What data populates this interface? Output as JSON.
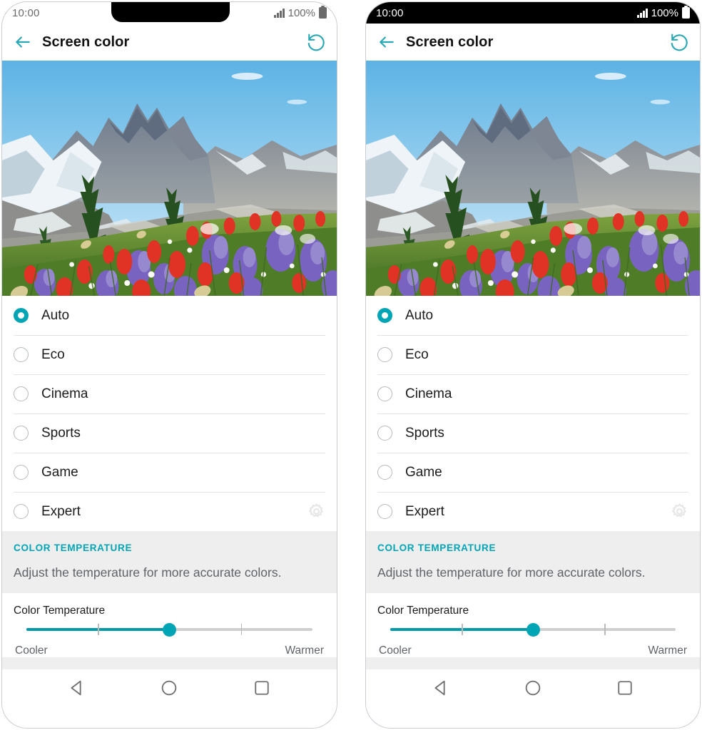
{
  "theme": {
    "accent": "#00a5b5",
    "band_bg": "#eeeeee",
    "text": "#1b1b1b",
    "muted": "#5f6368"
  },
  "status_bar": {
    "time": "10:00",
    "battery_percent": "100%",
    "signal_icon": "signal-bars-icon",
    "battery_icon": "battery-full-icon"
  },
  "app_bar": {
    "title": "Screen color",
    "back_icon": "back-arrow-icon",
    "reset_icon": "reset-restore-icon"
  },
  "hero": {
    "name": "wallpaper-preview",
    "description": "Mountain meadow with wildflowers under blue sky"
  },
  "modes": [
    {
      "label": "Auto",
      "selected": true,
      "has_gear": false
    },
    {
      "label": "Eco",
      "selected": false,
      "has_gear": false
    },
    {
      "label": "Cinema",
      "selected": false,
      "has_gear": false
    },
    {
      "label": "Sports",
      "selected": false,
      "has_gear": false
    },
    {
      "label": "Game",
      "selected": false,
      "has_gear": false
    },
    {
      "label": "Expert",
      "selected": false,
      "has_gear": true
    }
  ],
  "section": {
    "title": "COLOR TEMPERATURE",
    "description": "Adjust the temperature for more accurate colors."
  },
  "slider": {
    "label": "Color Temperature",
    "value_percent": 50,
    "tick_percents": [
      25,
      75
    ],
    "min_label": "Cooler",
    "max_label": "Warmer"
  },
  "nav_bar": {
    "back_icon": "nav-back-triangle-icon",
    "home_icon": "nav-home-circle-icon",
    "recents_icon": "nav-recents-square-icon"
  }
}
